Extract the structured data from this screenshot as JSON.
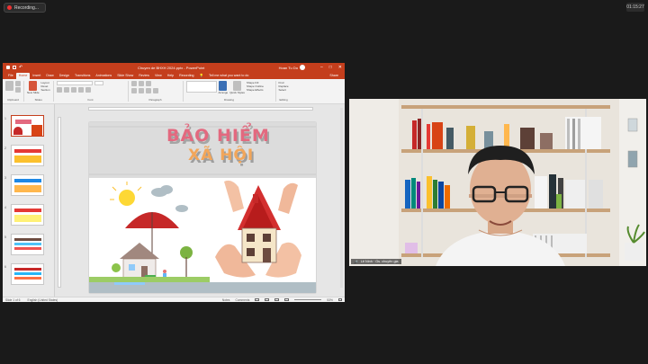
{
  "recording": {
    "label": "Recording..."
  },
  "topright": {
    "label": "01:15:27"
  },
  "ppt": {
    "title": "Chuyen de BHXH 2024.pptx - PowerPoint",
    "user": "Hoan Tu Do",
    "window_min": "–",
    "window_max": "□",
    "window_close": "✕",
    "tabs": [
      "File",
      "Home",
      "Insert",
      "Draw",
      "Design",
      "Transitions",
      "Animations",
      "Slide Show",
      "Review",
      "View",
      "Help",
      "Recording"
    ],
    "active_tab": "Home",
    "search_hint": "Tell me what you want to do",
    "share": "Share",
    "ribbon_groups": [
      {
        "label": "Clipboard",
        "lines": [
          "Paste"
        ]
      },
      {
        "label": "Slides",
        "lines": [
          "Layout",
          "Reset",
          "Section"
        ]
      },
      {
        "label": "Font",
        "lines": []
      },
      {
        "label": "Paragraph",
        "lines": []
      },
      {
        "label": "Drawing",
        "lines": [
          "Shape Fill",
          "Shape Outline",
          "Shape Effects"
        ]
      },
      {
        "label": "Editing",
        "lines": [
          "Find",
          "Replace",
          "Select"
        ]
      }
    ],
    "ribbon_new_slide": "New Slide",
    "ribbon_arrange": "Arrange",
    "ribbon_quick_styles": "Quick Styles",
    "thumb_numbers": [
      "1",
      "2",
      "3",
      "4",
      "5",
      "6"
    ],
    "status_left": "Slide 1 of 6",
    "status_lang": "English (United States)",
    "status_notes": "Notes",
    "status_comments": "Comments",
    "status_zoom": "53%"
  },
  "slide": {
    "title_line1": "BẢO HIỂM",
    "title_line2": "XÃ HỘI"
  },
  "cam": {
    "name_label": "Lê Ninh  ·  Gs. chuyên gia"
  },
  "colors": {
    "ppt_accent": "#c43e1c",
    "title_pink": "#e3697f",
    "title_orange": "#f2a65a"
  }
}
